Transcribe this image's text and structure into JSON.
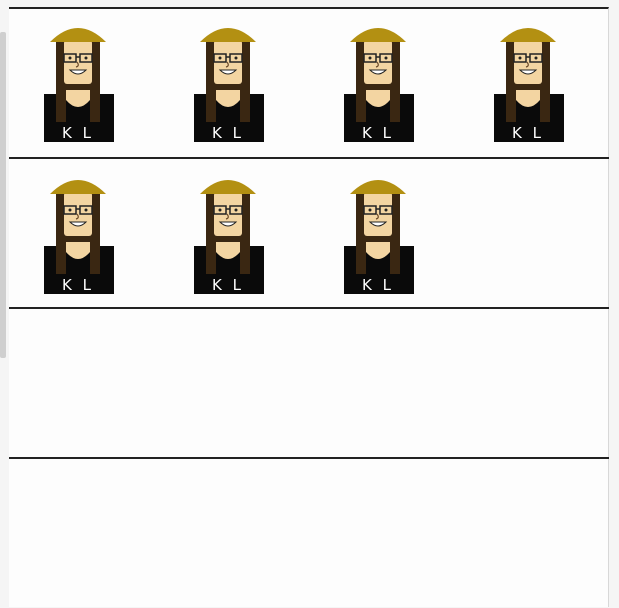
{
  "board": {
    "rows": [
      {
        "avatars": [
          {
            "initials": "K L"
          },
          {
            "initials": "K L"
          },
          {
            "initials": "K L"
          },
          {
            "initials": "K L"
          }
        ]
      },
      {
        "avatars": [
          {
            "initials": "K L"
          },
          {
            "initials": "K L"
          },
          {
            "initials": "K L"
          }
        ]
      },
      {
        "avatars": []
      },
      {
        "avatars": []
      }
    ]
  },
  "colors": {
    "hat": "#b39012",
    "hair": "#3a2712",
    "skin": "#f3d5a2",
    "shirt": "#0a0a0a",
    "divider": "#222222"
  }
}
